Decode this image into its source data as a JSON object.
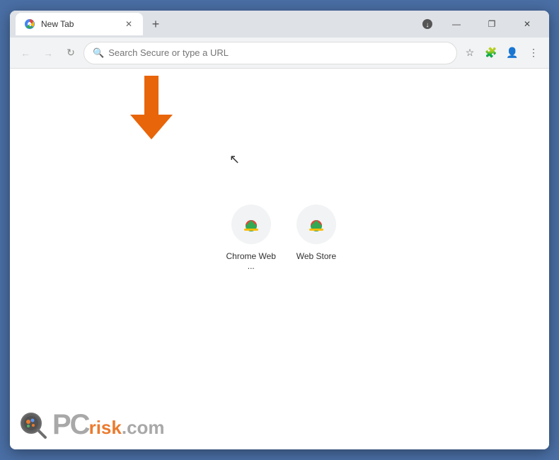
{
  "browser": {
    "tab": {
      "title": "New Tab",
      "favicon": "🔵"
    },
    "new_tab_button": "+",
    "window_controls": {
      "minimize": "—",
      "maximize": "❐",
      "close": "✕"
    },
    "toolbar": {
      "back": "←",
      "forward": "→",
      "reload": "↻",
      "address_placeholder": "Search Secure or type a URL",
      "bookmark_icon": "☆",
      "extensions_icon": "🧩",
      "profile_icon": "👤",
      "menu_icon": "⋮",
      "download_icon": "⬇"
    }
  },
  "shortcuts": [
    {
      "label": "Chrome Web ...",
      "id": "chrome-web-store-1"
    },
    {
      "label": "Web Store",
      "id": "web-store-2"
    }
  ],
  "watermark": {
    "pc": "PC",
    "risk": "risk",
    "dot_com": ".com"
  }
}
